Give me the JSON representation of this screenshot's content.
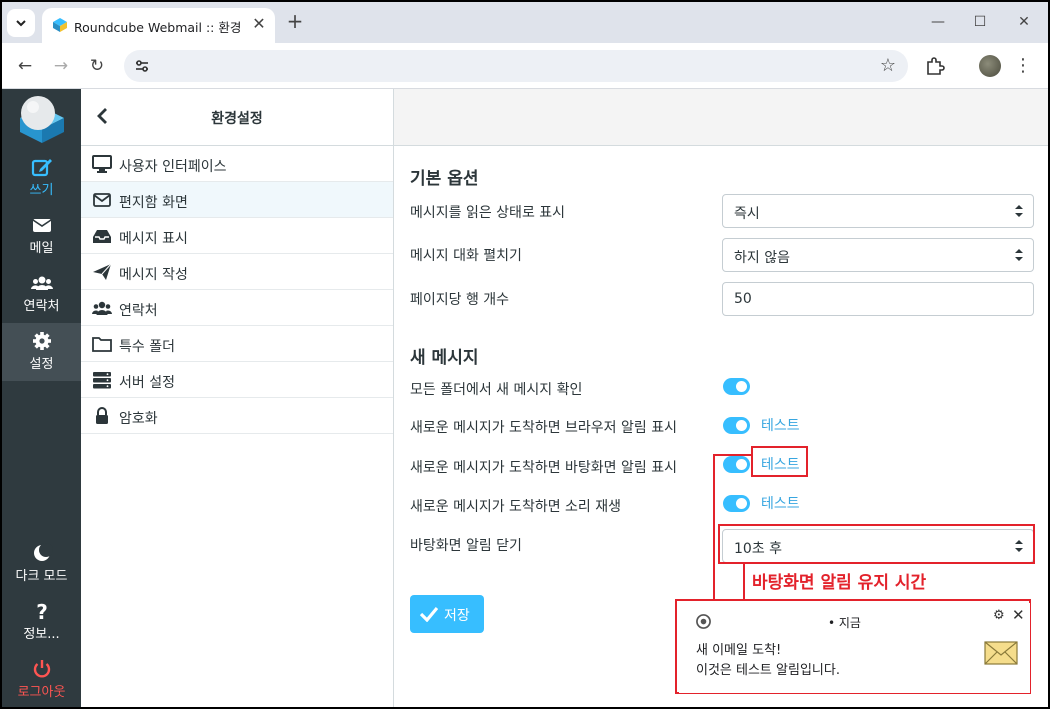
{
  "browser": {
    "tab_title": "Roundcube Webmail :: 환경설정",
    "new_tab": "+",
    "window_controls": [
      "minimize-icon",
      "maximize-icon",
      "close-icon"
    ],
    "url": ""
  },
  "nav": {
    "compose": "쓰기",
    "mail": "메일",
    "contacts": "연락처",
    "settings": "설정",
    "dark_mode": "다크 모드",
    "about": "정보...",
    "logout": "로그아웃"
  },
  "panel": {
    "title": "환경설정",
    "items": [
      {
        "label": "사용자 인터페이스",
        "icon": "monitor-icon"
      },
      {
        "label": "편지함 화면",
        "icon": "envelope-icon"
      },
      {
        "label": "메시지 표시",
        "icon": "inbox-icon"
      },
      {
        "label": "메시지 작성",
        "icon": "paper-plane-icon"
      },
      {
        "label": "연락처",
        "icon": "users-icon"
      },
      {
        "label": "특수 폴더",
        "icon": "folder-icon"
      },
      {
        "label": "서버 설정",
        "icon": "server-icon"
      },
      {
        "label": "암호화",
        "icon": "lock-icon"
      }
    ]
  },
  "content": {
    "section_basic": "기본 옵션",
    "mark_read_label": "메시지를 읽은 상태로 표시",
    "mark_read_value": "즉시",
    "expand_threads_label": "메시지 대화 펼치기",
    "expand_threads_value": "하지 않음",
    "rows_per_page_label": "페이지당 행 개수",
    "rows_per_page_value": "50",
    "section_new": "새 메시지",
    "check_all_folders_label": "모든 폴더에서 새 메시지 확인",
    "browser_notify_label": "새로운 메시지가 도착하면 브라우저 알림 표시",
    "desktop_notify_label": "새로운 메시지가 도착하면 바탕화면 알림 표시",
    "sound_label": "새로운 메시지가 도착하면 소리 재생",
    "test": "테스트",
    "close_after_label": "바탕화면 알림 닫기",
    "close_after_value": "10초 후",
    "save": "저장"
  },
  "annotation": {
    "text": "바탕화면 알림 유지 시간",
    "color": "#e3222b"
  },
  "notification": {
    "time": "•  지금",
    "title": "새 이메일 도착!",
    "body": "이것은 테스트 알림입니다."
  },
  "colors": {
    "accent": "#37beff",
    "nav_bg": "#2f3a3f",
    "logout": "#ff5552"
  }
}
